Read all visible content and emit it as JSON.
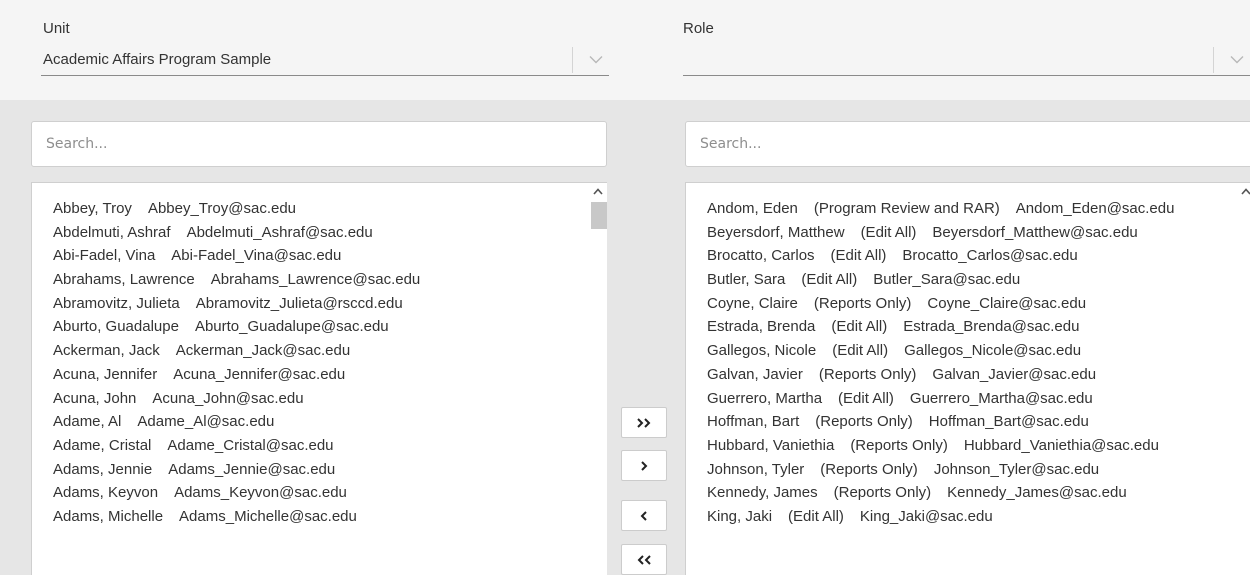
{
  "unit": {
    "label": "Unit",
    "value": "Academic Affairs Program Sample"
  },
  "role": {
    "label": "Role",
    "value": ""
  },
  "available": {
    "search_placeholder": "Search...",
    "items": [
      {
        "name": "Abbey, Troy",
        "email": "Abbey_Troy@sac.edu"
      },
      {
        "name": "Abdelmuti, Ashraf",
        "email": "Abdelmuti_Ashraf@sac.edu"
      },
      {
        "name": "Abi-Fadel, Vina",
        "email": "Abi-Fadel_Vina@sac.edu"
      },
      {
        "name": "Abrahams, Lawrence",
        "email": "Abrahams_Lawrence@sac.edu"
      },
      {
        "name": "Abramovitz, Julieta",
        "email": "Abramovitz_Julieta@rsccd.edu"
      },
      {
        "name": "Aburto, Guadalupe",
        "email": "Aburto_Guadalupe@sac.edu"
      },
      {
        "name": "Ackerman, Jack",
        "email": "Ackerman_Jack@sac.edu"
      },
      {
        "name": "Acuna, Jennifer",
        "email": "Acuna_Jennifer@sac.edu"
      },
      {
        "name": "Acuna, John",
        "email": "Acuna_John@sac.edu"
      },
      {
        "name": "Adame, Al",
        "email": "Adame_Al@sac.edu"
      },
      {
        "name": "Adame, Cristal",
        "email": "Adame_Cristal@sac.edu"
      },
      {
        "name": "Adams, Jennie",
        "email": "Adams_Jennie@sac.edu"
      },
      {
        "name": "Adams, Keyvon",
        "email": "Adams_Keyvon@sac.edu"
      },
      {
        "name": "Adams, Michelle",
        "email": "Adams_Michelle@sac.edu"
      }
    ]
  },
  "assigned": {
    "search_placeholder": "Search...",
    "items": [
      {
        "name": "Andom, Eden",
        "role": "(Program Review and RAR)",
        "email": "Andom_Eden@sac.edu"
      },
      {
        "name": "Beyersdorf, Matthew",
        "role": "(Edit All)",
        "email": "Beyersdorf_Matthew@sac.edu"
      },
      {
        "name": "Brocatto, Carlos",
        "role": "(Edit All)",
        "email": "Brocatto_Carlos@sac.edu"
      },
      {
        "name": "Butler, Sara",
        "role": "(Edit All)",
        "email": "Butler_Sara@sac.edu"
      },
      {
        "name": "Coyne, Claire",
        "role": "(Reports Only)",
        "email": "Coyne_Claire@sac.edu"
      },
      {
        "name": "Estrada, Brenda",
        "role": "(Edit All)",
        "email": "Estrada_Brenda@sac.edu"
      },
      {
        "name": "Gallegos, Nicole",
        "role": "(Edit All)",
        "email": "Gallegos_Nicole@sac.edu"
      },
      {
        "name": "Galvan, Javier",
        "role": "(Reports Only)",
        "email": "Galvan_Javier@sac.edu"
      },
      {
        "name": "Guerrero, Martha",
        "role": "(Edit All)",
        "email": "Guerrero_Martha@sac.edu"
      },
      {
        "name": "Hoffman, Bart",
        "role": "(Reports Only)",
        "email": "Hoffman_Bart@sac.edu"
      },
      {
        "name": "Hubbard, Vaniethia",
        "role": "(Reports Only)",
        "email": "Hubbard_Vaniethia@sac.edu"
      },
      {
        "name": "Johnson, Tyler",
        "role": "(Reports Only)",
        "email": "Johnson_Tyler@sac.edu"
      },
      {
        "name": "Kennedy, James",
        "role": "(Reports Only)",
        "email": "Kennedy_James@sac.edu"
      },
      {
        "name": "King, Jaki",
        "role": "(Edit All)",
        "email": "King_Jaki@sac.edu"
      }
    ]
  },
  "transfer_buttons": {
    "add_all": "››",
    "add": "›",
    "remove": "‹",
    "remove_all": "‹‹"
  },
  "icons": {
    "dropdown": "chevron-down-icon",
    "scroll": "chevron-up-icon"
  },
  "colors": {
    "page_bg": "#e6e6e6",
    "header_bg": "#f5f5f5",
    "panel_bg": "#ffffff",
    "text": "#333333",
    "placeholder": "#8e8e8e"
  }
}
